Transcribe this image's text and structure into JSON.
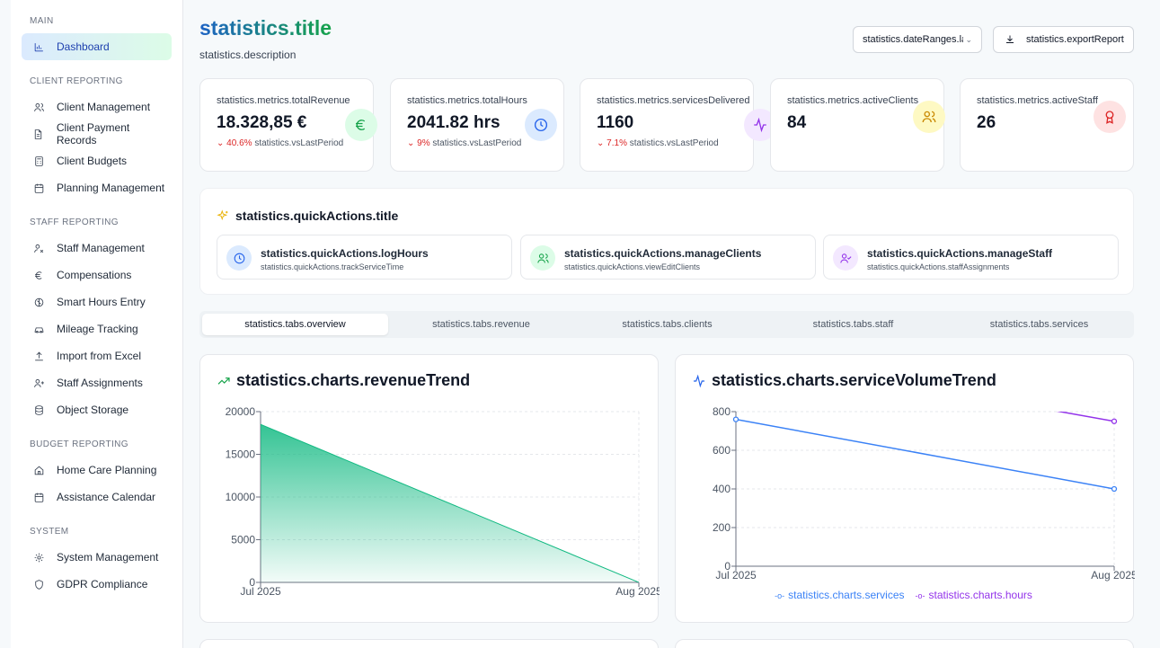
{
  "sidebar": {
    "sections": [
      {
        "title": "MAIN",
        "items": [
          {
            "label": "Dashboard",
            "icon": "bar-chart-icon",
            "active": true
          }
        ]
      },
      {
        "title": "CLIENT REPORTING",
        "items": [
          {
            "label": "Client Management",
            "icon": "users-icon"
          },
          {
            "label": "Client Payment Records",
            "icon": "file-text-icon"
          },
          {
            "label": "Client Budgets",
            "icon": "calculator-icon"
          },
          {
            "label": "Planning Management",
            "icon": "calendar-icon"
          }
        ]
      },
      {
        "title": "STAFF REPORTING",
        "items": [
          {
            "label": "Staff Management",
            "icon": "user-cog-icon"
          },
          {
            "label": "Compensations",
            "icon": "euro-icon"
          },
          {
            "label": "Smart Hours Entry",
            "icon": "brain-icon"
          },
          {
            "label": "Mileage Tracking",
            "icon": "car-icon"
          },
          {
            "label": "Import from Excel",
            "icon": "upload-icon"
          },
          {
            "label": "Staff Assignments",
            "icon": "user-plus-icon"
          },
          {
            "label": "Object Storage",
            "icon": "database-icon"
          }
        ]
      },
      {
        "title": "BUDGET REPORTING",
        "items": [
          {
            "label": "Home Care Planning",
            "icon": "home-icon"
          },
          {
            "label": "Assistance Calendar",
            "icon": "calendar-icon"
          }
        ]
      },
      {
        "title": "SYSTEM",
        "items": [
          {
            "label": "System Management",
            "icon": "settings-icon"
          },
          {
            "label": "GDPR Compliance",
            "icon": "shield-icon"
          }
        ]
      }
    ]
  },
  "header": {
    "title": "statistics.title",
    "description": "statistics.description",
    "date_range": "statistics.dateRanges.last",
    "export_label": "statistics.exportReport"
  },
  "metrics": [
    {
      "label": "statistics.metrics.totalRevenue",
      "value": "18.328,85 €",
      "change": "40.6%",
      "vs": "statistics.vsLastPeriod",
      "icon": "euro-icon",
      "color": "#16a34a",
      "bg": "#dcfce7"
    },
    {
      "label": "statistics.metrics.totalHours",
      "value": "2041.82 hrs",
      "change": "9%",
      "vs": "statistics.vsLastPeriod",
      "icon": "clock-icon",
      "color": "#2563eb",
      "bg": "#dbeafe"
    },
    {
      "label": "statistics.metrics.servicesDelivered",
      "value": "1160",
      "change": "7.1%",
      "vs": "statistics.vsLastPeriod",
      "icon": "activity-icon",
      "color": "#9333ea",
      "bg": "#f3e8ff"
    },
    {
      "label": "statistics.metrics.activeClients",
      "value": "84",
      "icon": "users-icon",
      "color": "#ca8a04",
      "bg": "#fef9c3"
    },
    {
      "label": "statistics.metrics.activeStaff",
      "value": "26",
      "icon": "award-icon",
      "color": "#dc2626",
      "bg": "#fee2e2"
    }
  ],
  "quick_actions": {
    "title": "statistics.quickActions.title",
    "items": [
      {
        "title": "statistics.quickActions.logHours",
        "subtitle": "statistics.quickActions.trackServiceTime",
        "icon": "clock-icon",
        "color": "#2563eb",
        "bg": "#dbeafe"
      },
      {
        "title": "statistics.quickActions.manageClients",
        "subtitle": "statistics.quickActions.viewEditClients",
        "icon": "users-icon",
        "color": "#16a34a",
        "bg": "#dcfce7"
      },
      {
        "title": "statistics.quickActions.manageStaff",
        "subtitle": "statistics.quickActions.staffAssignments",
        "icon": "user-check-icon",
        "color": "#9333ea",
        "bg": "#f3e8ff"
      }
    ]
  },
  "tabs": [
    {
      "label": "statistics.tabs.overview",
      "active": true
    },
    {
      "label": "statistics.tabs.revenue"
    },
    {
      "label": "statistics.tabs.clients"
    },
    {
      "label": "statistics.tabs.staff"
    },
    {
      "label": "statistics.tabs.services"
    }
  ],
  "charts": {
    "revenue_title": "statistics.charts.revenueTrend",
    "volume_title": "statistics.charts.serviceVolumeTrend"
  },
  "chart_data": [
    {
      "type": "area",
      "title": "statistics.charts.revenueTrend",
      "x": [
        "Jul 2025",
        "Aug 2025"
      ],
      "series": [
        {
          "values": [
            18500,
            0
          ],
          "color": "#10b981"
        }
      ],
      "ylim": [
        0,
        20000
      ],
      "yticks": [
        0,
        5000,
        10000,
        15000,
        20000
      ],
      "grid": true
    },
    {
      "type": "line",
      "title": "statistics.charts.serviceVolumeTrend",
      "x": [
        "Jul 2025",
        "Aug 2025"
      ],
      "series": [
        {
          "name": "statistics.charts.services",
          "values": [
            760,
            400
          ],
          "color": "#3b82f6"
        },
        {
          "name": "statistics.charts.hours",
          "values": [
            1100,
            750
          ],
          "color": "#9333ea"
        }
      ],
      "ylim": [
        0,
        800
      ],
      "yticks": [
        0,
        200,
        400,
        600,
        800
      ],
      "grid": true,
      "legend": "bottom"
    }
  ]
}
